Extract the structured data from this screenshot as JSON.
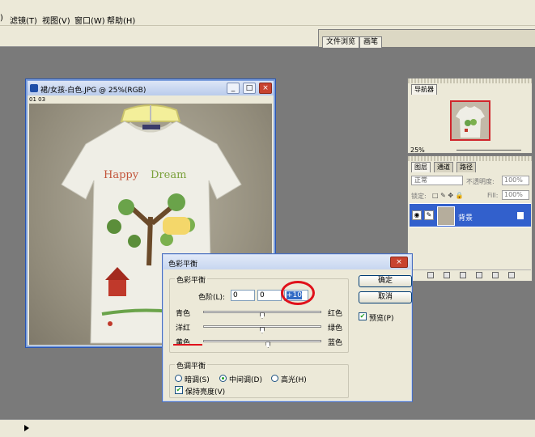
{
  "menubar": {
    "items": [
      "滤镜(T)",
      "视图(V)",
      "窗口(W)",
      "帮助(H)"
    ]
  },
  "well": {
    "tabs": [
      "文件浏览",
      "画笔"
    ]
  },
  "document": {
    "title": "裙/女孩-白色.JPG @ 25%(RGB)",
    "strip": "01 03"
  },
  "navigator": {
    "tab": "导航器",
    "zoom": "25%"
  },
  "layers": {
    "tabs": [
      "图层",
      "通道",
      "路径"
    ],
    "blend_mode": "正常",
    "opacity_label": "不透明度:",
    "opacity_value": "100%",
    "lock_label": "锁定:",
    "fill_label": "Fill:",
    "fill_value": "100%",
    "layer_name": "背景"
  },
  "dialog": {
    "title": "色彩平衡",
    "group_balance": "色彩平衡",
    "levels_label": "色阶(L):",
    "levels": [
      "0",
      "0",
      "+10"
    ],
    "sliders": [
      {
        "left": "青色",
        "right": "红色",
        "value": 0
      },
      {
        "left": "洋红",
        "right": "绿色",
        "value": 0
      },
      {
        "left": "黄色",
        "right": "蓝色",
        "value": 10
      }
    ],
    "group_tone": "色调平衡",
    "tones": [
      "暗调(S)",
      "中间调(D)",
      "高光(H)"
    ],
    "tone_selected": "中间调(D)",
    "preserve_luminosity": "保持亮度(V)",
    "ok_label": "确定",
    "cancel_label": "取消",
    "preview_label": "预览(P)",
    "accent_color": "#e0111b"
  }
}
